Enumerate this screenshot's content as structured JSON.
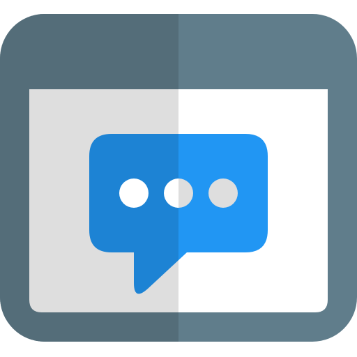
{
  "icon": {
    "name": "browser-chat-icon",
    "parts": [
      "browser-window-icon",
      "chat-bubble-icon",
      "typing-dots-icon"
    ]
  },
  "colors": {
    "frame_light": "#607D8B",
    "frame_dark": "#546D79",
    "content_light": "#FFFFFF",
    "content_dark": "#DEDEDE",
    "bubble_light": "#2196F3",
    "bubble_dark": "#1D83D4",
    "dot_light": "#DEDEDE",
    "dot_dark": "#FFFFFF"
  }
}
